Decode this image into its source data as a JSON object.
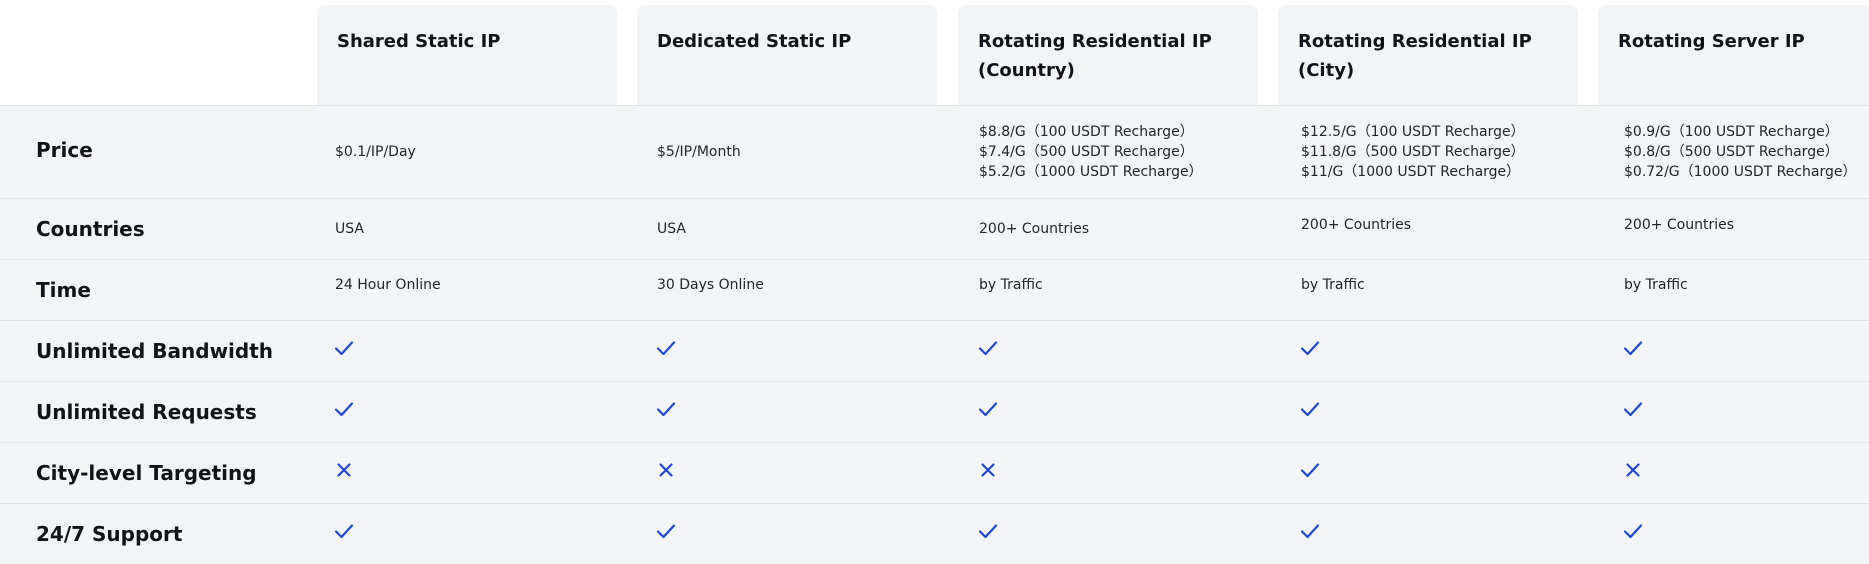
{
  "plans": [
    {
      "title": "Shared Static IP"
    },
    {
      "title": "Dedicated Static IP"
    },
    {
      "title": "Rotating Residential IP (Country)"
    },
    {
      "title": "Rotating Residential IP (City)"
    },
    {
      "title": "Rotating Server IP"
    }
  ],
  "rows": {
    "price": {
      "label": "Price",
      "values": [
        [
          "$0.1/IP/Day"
        ],
        [
          "$5/IP/Month"
        ],
        [
          "$8.8/G（100 USDT Recharge）",
          "$7.4/G（500 USDT Recharge）",
          "$5.2/G（1000 USDT Recharge）"
        ],
        [
          "$12.5/G（100 USDT Recharge）",
          "$11.8/G（500 USDT Recharge）",
          "$11/G（1000 USDT Recharge）"
        ],
        [
          "$0.9/G（100 USDT Recharge）",
          "$0.8/G（500 USDT Recharge）",
          "$0.72/G（1000 USDT Recharge）"
        ]
      ]
    },
    "countries": {
      "label": "Countries",
      "values": [
        "USA",
        "USA",
        "200+ Countries",
        "200+ Countries",
        "200+ Countries"
      ]
    },
    "time": {
      "label": "Time",
      "values": [
        "24 Hour Online",
        "30 Days Online",
        "by Traffic",
        "by Traffic",
        "by Traffic"
      ]
    },
    "bandwidth": {
      "label": "Unlimited Bandwidth",
      "values": [
        true,
        true,
        true,
        true,
        true
      ]
    },
    "requests": {
      "label": "Unlimited Requests",
      "values": [
        true,
        true,
        true,
        true,
        true
      ]
    },
    "city": {
      "label": "City-level Targeting",
      "values": [
        false,
        false,
        false,
        true,
        false
      ]
    },
    "support": {
      "label": "24/7 Support",
      "values": [
        true,
        true,
        true,
        true,
        true
      ]
    }
  },
  "icons": {
    "included": "check-icon",
    "excluded": "cross-icon"
  },
  "colors": {
    "accent": "#1f47d6",
    "table_bg": "#f3f4f6"
  }
}
